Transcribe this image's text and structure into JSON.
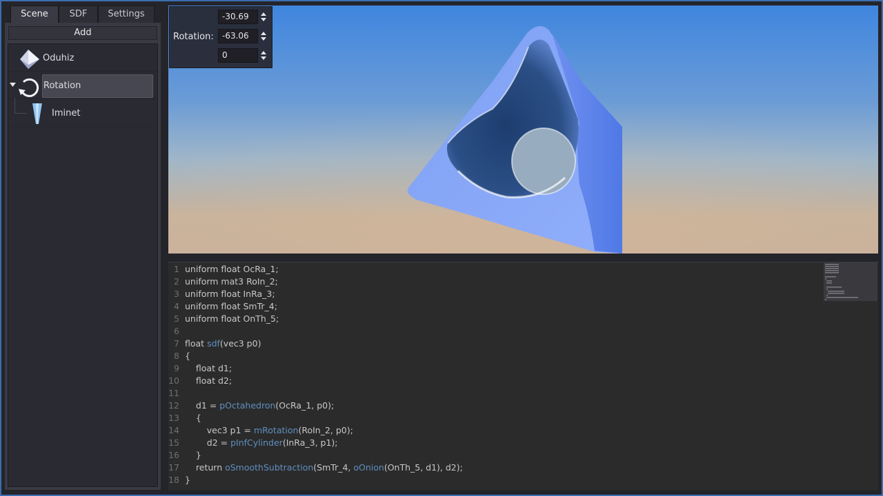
{
  "tabs": [
    {
      "label": "Scene",
      "active": true
    },
    {
      "label": "SDF",
      "active": false
    },
    {
      "label": "Settings",
      "active": false
    }
  ],
  "add_label": "Add",
  "tree": {
    "items": [
      {
        "label": "Oduhiz",
        "icon": "octahedron-icon"
      },
      {
        "label": "Rotation",
        "icon": "rotation-icon",
        "selected": true,
        "expanded": true
      },
      {
        "label": "Iminet",
        "icon": "cylinder-icon"
      }
    ]
  },
  "rotation": {
    "label": "Rotation:",
    "x": "-30.69",
    "y": "-63.06",
    "z": "0"
  },
  "colors": {
    "accent": "#3b6fb0",
    "function": "#5f8fbf",
    "shape": "#6f8ff5"
  },
  "code_lines": [
    {
      "n": "1",
      "parts": [
        [
          "uniform float OcRa_1;",
          false
        ]
      ]
    },
    {
      "n": "2",
      "parts": [
        [
          "uniform mat3 RoIn_2;",
          false
        ]
      ]
    },
    {
      "n": "3",
      "parts": [
        [
          "uniform float InRa_3;",
          false
        ]
      ]
    },
    {
      "n": "4",
      "parts": [
        [
          "uniform float SmTr_4;",
          false
        ]
      ]
    },
    {
      "n": "5",
      "parts": [
        [
          "uniform float OnTh_5;",
          false
        ]
      ]
    },
    {
      "n": "6",
      "parts": []
    },
    {
      "n": "7",
      "parts": [
        [
          "float ",
          false
        ],
        [
          "sdf",
          true
        ],
        [
          "(vec3 p0)",
          false
        ]
      ]
    },
    {
      "n": "8",
      "parts": [
        [
          "{",
          false
        ]
      ]
    },
    {
      "n": "9",
      "parts": [
        [
          "    float d1;",
          false
        ]
      ]
    },
    {
      "n": "10",
      "parts": [
        [
          "    float d2;",
          false
        ]
      ]
    },
    {
      "n": "11",
      "parts": []
    },
    {
      "n": "12",
      "parts": [
        [
          "    d1 = ",
          false
        ],
        [
          "pOctahedron",
          true
        ],
        [
          "(OcRa_1, p0);",
          false
        ]
      ]
    },
    {
      "n": "13",
      "parts": [
        [
          "    {",
          false
        ]
      ]
    },
    {
      "n": "14",
      "parts": [
        [
          "        vec3 p1 = ",
          false
        ],
        [
          "mRotation",
          true
        ],
        [
          "(RoIn_2, p0);",
          false
        ]
      ]
    },
    {
      "n": "15",
      "parts": [
        [
          "        d2 = ",
          false
        ],
        [
          "pInfCylinder",
          true
        ],
        [
          "(InRa_3, p1);",
          false
        ]
      ]
    },
    {
      "n": "16",
      "parts": [
        [
          "    }",
          false
        ]
      ]
    },
    {
      "n": "17",
      "parts": [
        [
          "    return ",
          false
        ],
        [
          "oSmoothSubtraction",
          true
        ],
        [
          "(SmTr_4, ",
          false
        ],
        [
          "oOnion",
          true
        ],
        [
          "(OnTh_5, d1), d2);",
          false
        ]
      ]
    },
    {
      "n": "18",
      "parts": [
        [
          "}",
          false
        ]
      ]
    }
  ]
}
